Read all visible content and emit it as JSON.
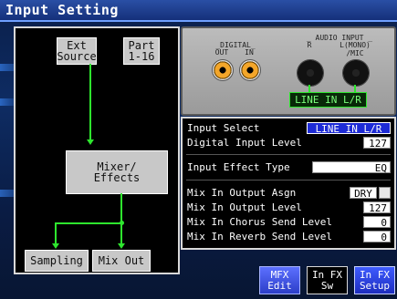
{
  "window": {
    "title": "Input Setting"
  },
  "flow": {
    "ext_source": "Ext\nSource",
    "part": "Part\n1-16",
    "mixer": "Mixer/\nEffects",
    "sampling": "Sampling",
    "mix_out": "Mix Out"
  },
  "jacks": {
    "digital_header": "_DIGITAL_",
    "digital_out": "OUT",
    "digital_in": "IN",
    "audio_header": "_ AUDIO INPUT _",
    "audio_r": "R",
    "audio_l": "L(MONO)\n/MIC",
    "line_badge": "LINE IN L/R"
  },
  "params": {
    "input_select": {
      "label": "Input Select",
      "value": "LINE IN L/R"
    },
    "digital_input_level": {
      "label": "Digital Input Level",
      "value": "127"
    },
    "input_effect_type": {
      "label": "Input Effect Type",
      "value": "EQ"
    },
    "mix_in_output_assign": {
      "label": "Mix In Output Asgn",
      "value": "DRY"
    },
    "mix_in_output_level": {
      "label": "Mix In Output Level",
      "value": "127"
    },
    "mix_in_chorus_send": {
      "label": "Mix In Chorus Send Level",
      "value": "0"
    },
    "mix_in_reverb_send": {
      "label": "Mix In Reverb Send Level",
      "value": "0"
    }
  },
  "buttons": {
    "mfx_edit": "MFX\nEdit",
    "in_fx_sw": "In FX\nSw",
    "in_fx_setup": "In FX\nSetup"
  },
  "colors": {
    "selected": "#1d2bd6",
    "signal": "#2ee62e",
    "title_bar": "#15307a"
  }
}
